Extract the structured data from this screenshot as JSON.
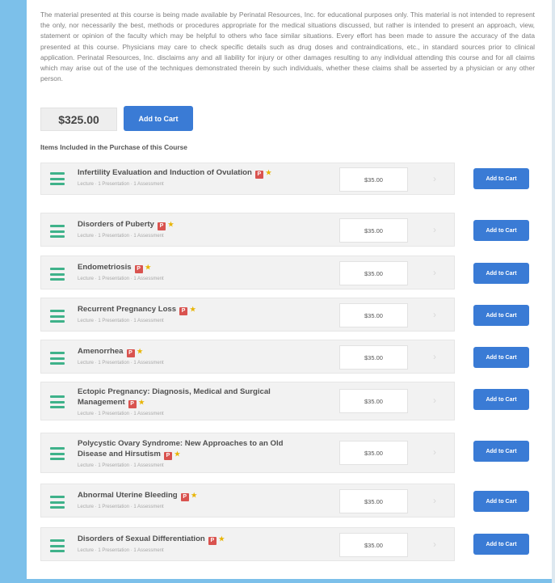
{
  "course": {
    "disclaimer": "The material presented at this course is being made available by Perinatal Resources, Inc. for educational purposes only. This material is not intended to represent the only, nor necessarily the best, methods or procedures appropriate for the medical situations discussed, but rather is intended to present an approach, view, statement or opinion of the faculty which may be helpful to others who face similar situations. Every effort has been made to assure the accuracy of the data presented at this course. Physicians may care to check specific details such as drug doses and contraindications, etc., in standard sources prior to clinical application. Perinatal Resources, Inc. disclaims any and all liability for injury or other damages resulting to any individual attending this course and for all claims which may arise out of the use of the techniques demonstrated therein by such individuals, whether these claims shall be asserted by a physician or any other person.",
    "price": "$325.00",
    "add_to_cart_label": "Add to Cart"
  },
  "included_title": "Items Included in the Purchase of this Course",
  "items": [
    {
      "title": "Infertility Evaluation and Induction of Ovulation",
      "subtitle": "Lecture · 1 Presentation · 1 Assessment",
      "price": "$35.00",
      "badge": "P",
      "star": "★",
      "arrow": "›",
      "add_label": "Add to Cart"
    },
    {
      "title": "Disorders of Puberty",
      "subtitle": "Lecture · 1 Presentation · 1 Assessment",
      "price": "$35.00",
      "badge": "P",
      "star": "★",
      "arrow": "›",
      "add_label": "Add to Cart"
    },
    {
      "title": "Endometriosis",
      "subtitle": "Lecture · 1 Presentation · 1 Assessment",
      "price": "$35.00",
      "badge": "P",
      "star": "★",
      "arrow": "›",
      "add_label": "Add to Cart"
    },
    {
      "title": "Recurrent Pregnancy Loss",
      "subtitle": "Lecture · 1 Presentation · 1 Assessment",
      "price": "$35.00",
      "badge": "P",
      "star": "★",
      "arrow": "›",
      "add_label": "Add to Cart"
    },
    {
      "title": "Amenorrhea",
      "subtitle": "Lecture · 1 Presentation · 1 Assessment",
      "price": "$35.00",
      "badge": "P",
      "star": "★",
      "arrow": "›",
      "add_label": "Add to Cart"
    },
    {
      "title": "Ectopic Pregnancy: Diagnosis, Medical and Surgical Management",
      "subtitle": "Lecture · 1 Presentation · 1 Assessment",
      "price": "$35.00",
      "badge": "P",
      "star": "★",
      "arrow": "›",
      "add_label": "Add to Cart"
    },
    {
      "title": "Polycystic Ovary Syndrome: New Approaches to an Old Disease and Hirsutism",
      "subtitle": "Lecture · 1 Presentation · 1 Assessment",
      "price": "$35.00",
      "badge": "P",
      "star": "★",
      "arrow": "›",
      "add_label": "Add to Cart"
    },
    {
      "title": "Abnormal Uterine Bleeding",
      "subtitle": "Lecture · 1 Presentation · 1 Assessment",
      "price": "$35.00",
      "badge": "P",
      "star": "★",
      "arrow": "›",
      "add_label": "Add to Cart"
    },
    {
      "title": "Disorders of Sexual Differentiation",
      "subtitle": "Lecture · 1 Presentation · 1 Assessment",
      "price": "$35.00",
      "badge": "P",
      "star": "★",
      "arrow": "›",
      "add_label": "Add to Cart"
    }
  ],
  "icons": {
    "item_icon": "list-icon",
    "badge_icon": "pdf-badge-icon",
    "star_icon": "star-icon",
    "arrow_icon": "chevron-right-icon"
  },
  "colors": {
    "accent_blue": "#3a7bd5",
    "frame_blue": "#7cc0ea",
    "icon_green": "#3fb28a",
    "badge_red": "#d9534f",
    "star_yellow": "#e8b400"
  }
}
